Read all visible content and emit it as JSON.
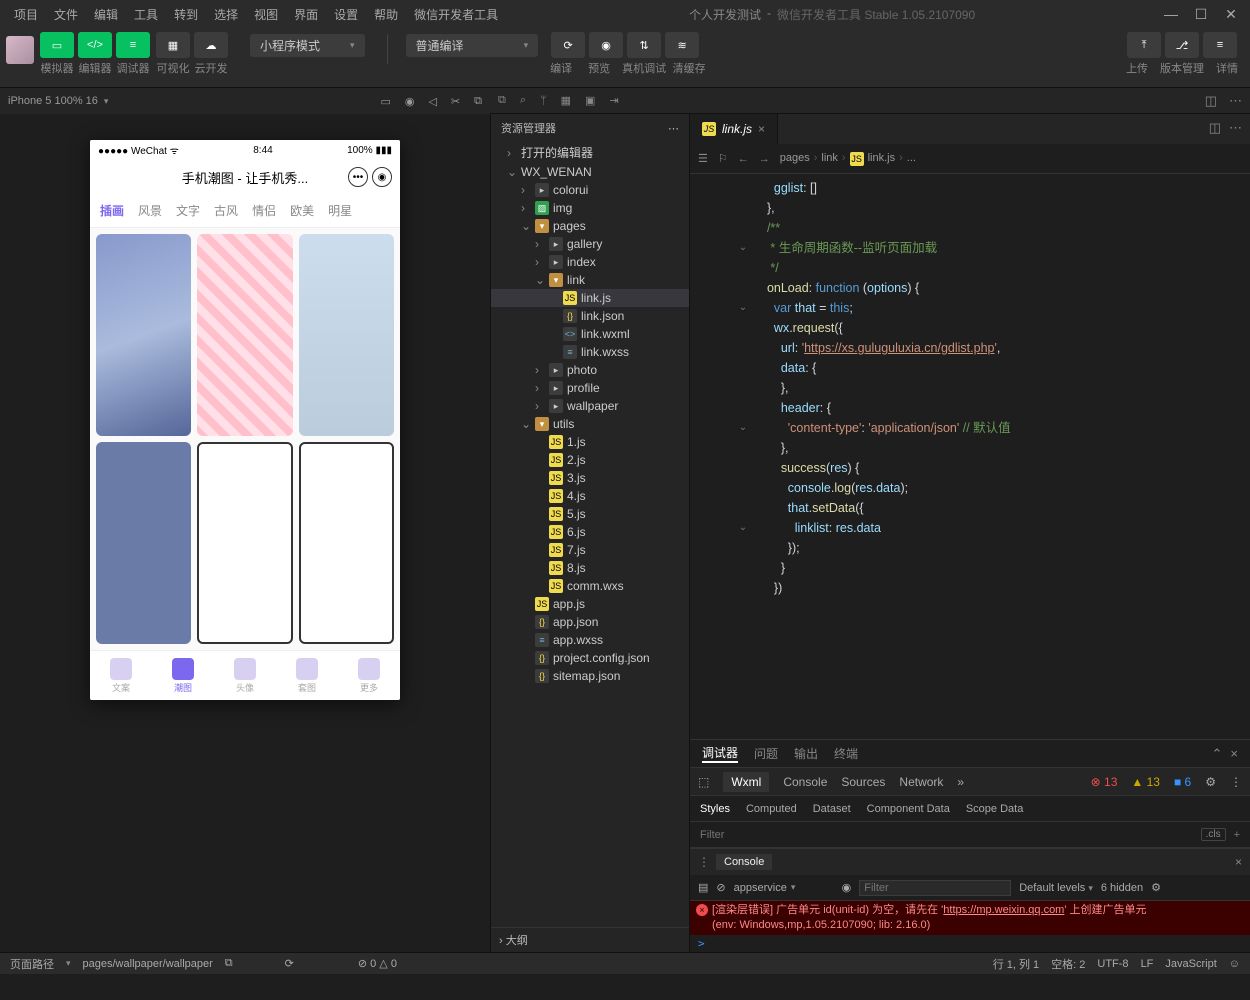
{
  "titlebar": {
    "menus": [
      "项目",
      "文件",
      "编辑",
      "工具",
      "转到",
      "选择",
      "视图",
      "界面",
      "设置",
      "帮助",
      "微信开发者工具"
    ],
    "app_name": "个人开发测试",
    "app_sub": "微信开发者工具 Stable 1.05.2107090"
  },
  "toolbar": {
    "groups": {
      "g1": [
        "模拟器",
        "编辑器",
        "调试器"
      ],
      "g2": [
        "可视化",
        "云开发"
      ]
    },
    "mode_dropdown": "小程序模式",
    "compile_dropdown": "普通编译",
    "compile_actions": [
      "编译",
      "预览",
      "真机调试",
      "清缓存"
    ],
    "right_actions": [
      "上传",
      "版本管理",
      "详情"
    ]
  },
  "simulator": {
    "device_label": "iPhone 5 100% 16",
    "phone": {
      "carrier": "●●●●● WeChat",
      "time": "8:44",
      "battery": "100%",
      "title": "手机潮图 - 让手机秀...",
      "tabs": [
        "插画",
        "风景",
        "文字",
        "古风",
        "情侣",
        "欧美",
        "明星"
      ],
      "active_tab": 0,
      "tabbar": [
        "文案",
        "潮图",
        "头像",
        "套图",
        "更多"
      ],
      "tabbar_active": 1
    }
  },
  "explorer": {
    "title": "资源管理器",
    "sections": {
      "open_editors": "打开的编辑器",
      "project": "WX_WENAN"
    },
    "tree": [
      {
        "name": "colorui",
        "type": "folder",
        "indent": 2
      },
      {
        "name": "img",
        "type": "img-folder",
        "indent": 2
      },
      {
        "name": "pages",
        "type": "folder-open",
        "indent": 2,
        "expanded": true
      },
      {
        "name": "gallery",
        "type": "folder",
        "indent": 3
      },
      {
        "name": "index",
        "type": "folder",
        "indent": 3
      },
      {
        "name": "link",
        "type": "folder-open",
        "indent": 3,
        "expanded": true
      },
      {
        "name": "link.js",
        "type": "js",
        "indent": 4,
        "selected": true
      },
      {
        "name": "link.json",
        "type": "json",
        "indent": 4
      },
      {
        "name": "link.wxml",
        "type": "wxml",
        "indent": 4
      },
      {
        "name": "link.wxss",
        "type": "wxss",
        "indent": 4
      },
      {
        "name": "photo",
        "type": "folder",
        "indent": 3
      },
      {
        "name": "profile",
        "type": "folder",
        "indent": 3
      },
      {
        "name": "wallpaper",
        "type": "folder",
        "indent": 3
      },
      {
        "name": "utils",
        "type": "folder-open",
        "indent": 2,
        "expanded": true
      },
      {
        "name": "1.js",
        "type": "js",
        "indent": 3
      },
      {
        "name": "2.js",
        "type": "js",
        "indent": 3
      },
      {
        "name": "3.js",
        "type": "js",
        "indent": 3
      },
      {
        "name": "4.js",
        "type": "js",
        "indent": 3
      },
      {
        "name": "5.js",
        "type": "js",
        "indent": 3
      },
      {
        "name": "6.js",
        "type": "js",
        "indent": 3
      },
      {
        "name": "7.js",
        "type": "js",
        "indent": 3
      },
      {
        "name": "8.js",
        "type": "js",
        "indent": 3
      },
      {
        "name": "comm.wxs",
        "type": "js",
        "indent": 3
      },
      {
        "name": "app.js",
        "type": "js",
        "indent": 2
      },
      {
        "name": "app.json",
        "type": "json",
        "indent": 2
      },
      {
        "name": "app.wxss",
        "type": "wxss",
        "indent": 2
      },
      {
        "name": "project.config.json",
        "type": "json",
        "indent": 2
      },
      {
        "name": "sitemap.json",
        "type": "json",
        "indent": 2
      }
    ],
    "outline": "大纲"
  },
  "editor": {
    "tab_file": "link.js",
    "breadcrumb": [
      "pages",
      "link",
      "link.js",
      "..."
    ],
    "code": {
      "url": "https://xs.guluguluxia.cn/gdlist.php",
      "comment_header": "/**",
      "comment_body": " * 生命周期函数--监听页面加载",
      "comment_footer": " */",
      "default_comment": "// 默认值"
    }
  },
  "debugger": {
    "top_tabs": [
      "调试器",
      "问题",
      "输出",
      "终端"
    ],
    "inspector_tabs": [
      "Wxml",
      "Console",
      "Sources",
      "Network"
    ],
    "badges": {
      "errors": "13",
      "warnings": "13",
      "info": "6"
    },
    "styles_tabs": [
      "Styles",
      "Computed",
      "Dataset",
      "Component Data",
      "Scope Data"
    ],
    "filter_placeholder": "Filter",
    "cls_label": ".cls"
  },
  "console": {
    "label": "Console",
    "context": "appservice",
    "filter_placeholder": "Filter",
    "levels": "Default levels",
    "hidden": "6 hidden",
    "error_line1_a": "[渲染层错误] 广告单元 id(unit-id) 为空，请先在 '",
    "error_link": "https://mp.weixin.qq.com",
    "error_line1_b": "' 上创建广告单元",
    "error_line2": "(env: Windows,mp,1.05.2107090; lib: 2.16.0)",
    "prompt": ">"
  },
  "statusbar": {
    "path_label": "页面路径",
    "path": "pages/wallpaper/wallpaper",
    "err_warn": "⊘ 0 △ 0",
    "cursor": "行 1, 列 1",
    "spaces": "空格: 2",
    "encoding": "UTF-8",
    "eol": "LF",
    "lang": "JavaScript"
  }
}
